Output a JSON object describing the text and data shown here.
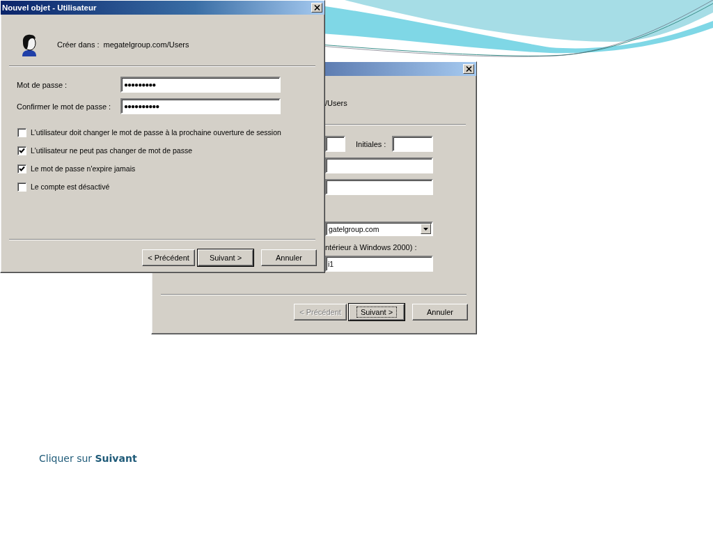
{
  "slide": {
    "caption": "Cliquer sur **Suivant**"
  },
  "back_dialog": {
    "path_fragment": "/Users",
    "initials_label": "Initiales :",
    "domain_dropdown": {
      "value": "gatelgroup.com"
    },
    "logon_label": "ntérieur à Windows 2000) :",
    "logon_field": {
      "value": "i1"
    },
    "buttons": [
      {
        "label": "< Précédent",
        "disabled": true,
        "default": false,
        "focused": false
      },
      {
        "label": "Suivant >",
        "disabled": false,
        "default": true,
        "focused": true
      },
      {
        "label": "Annuler",
        "disabled": false,
        "default": false,
        "focused": false
      }
    ]
  },
  "front_dialog": {
    "title": "Nouvel objet - Utilisateur",
    "create_in_label": "Créer dans :",
    "create_in_path": "megatelgroup.com/Users",
    "fields": [
      {
        "label": "Mot de passe :",
        "value": "●●●●●●●●●"
      },
      {
        "label": "Confirmer le mot de passe :",
        "value": "●●●●●●●●●●"
      }
    ],
    "checkboxes": [
      {
        "label": "L'utilisateur doit changer le mot de passe à la prochaine ouverture de session",
        "checked": false
      },
      {
        "label": "L'utilisateur ne peut pas changer de mot de passe",
        "checked": true
      },
      {
        "label": "Le mot de passe n'expire jamais",
        "checked": true
      },
      {
        "label": "Le compte est désactivé",
        "checked": false
      }
    ],
    "buttons": [
      {
        "label": "< Précédent",
        "disabled": false,
        "default": false,
        "focused": false
      },
      {
        "label": "Suivant >",
        "disabled": false,
        "default": true,
        "focused": false
      },
      {
        "label": "Annuler",
        "disabled": false,
        "default": false,
        "focused": false
      }
    ]
  }
}
